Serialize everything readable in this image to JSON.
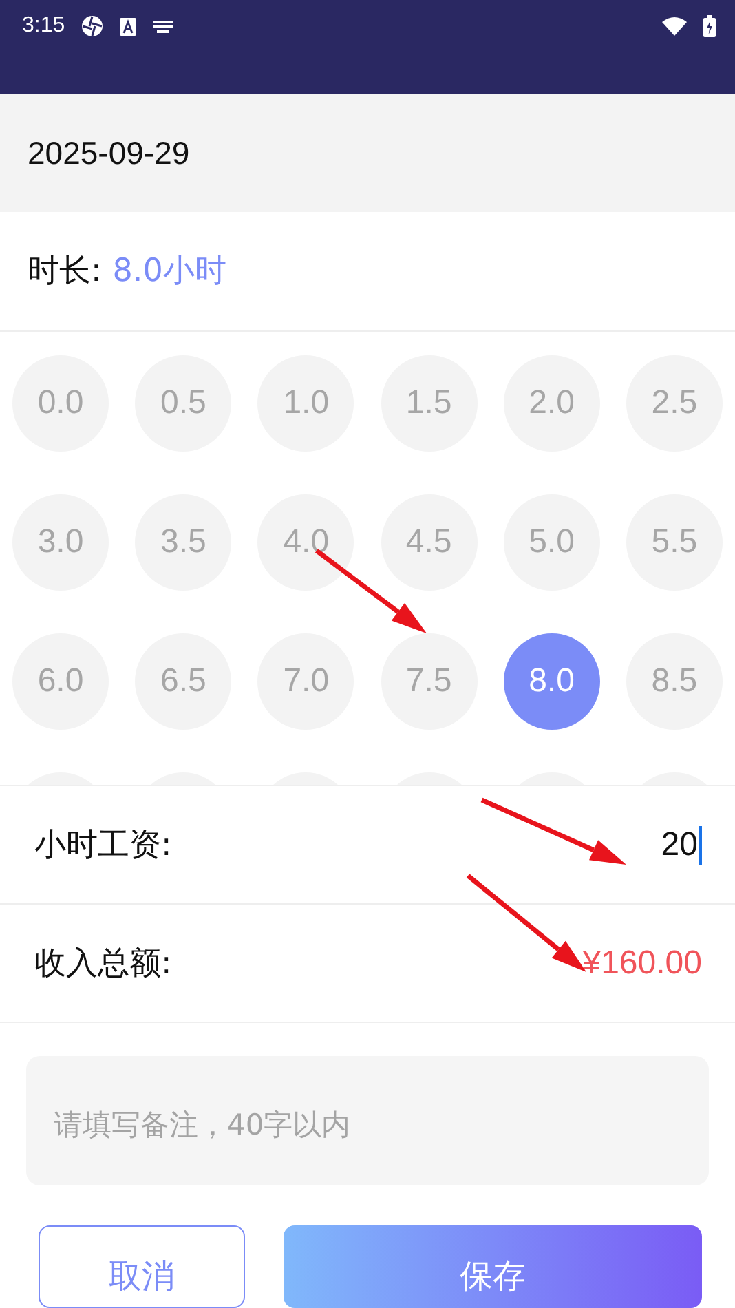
{
  "status_bar": {
    "time": "3:15"
  },
  "date": "2025-09-29",
  "duration": {
    "label": "时长:",
    "value": "8.0小时"
  },
  "hour_options": [
    {
      "label": "0.0",
      "selected": false
    },
    {
      "label": "0.5",
      "selected": false
    },
    {
      "label": "1.0",
      "selected": false
    },
    {
      "label": "1.5",
      "selected": false
    },
    {
      "label": "2.0",
      "selected": false
    },
    {
      "label": "2.5",
      "selected": false
    },
    {
      "label": "3.0",
      "selected": false
    },
    {
      "label": "3.5",
      "selected": false
    },
    {
      "label": "4.0",
      "selected": false
    },
    {
      "label": "4.5",
      "selected": false
    },
    {
      "label": "5.0",
      "selected": false
    },
    {
      "label": "5.5",
      "selected": false
    },
    {
      "label": "6.0",
      "selected": false
    },
    {
      "label": "6.5",
      "selected": false
    },
    {
      "label": "7.0",
      "selected": false
    },
    {
      "label": "7.5",
      "selected": false
    },
    {
      "label": "8.0",
      "selected": true
    },
    {
      "label": "8.5",
      "selected": false
    }
  ],
  "hourly_wage": {
    "label": "小时工资:",
    "value": "20"
  },
  "total_income": {
    "label": "收入总额:",
    "value": "¥160.00"
  },
  "note": {
    "placeholder": "请填写备注，40字以内"
  },
  "buttons": [
    {
      "label": "取消",
      "kind": "outline"
    },
    {
      "label": "保存",
      "kind": "primary"
    }
  ]
}
